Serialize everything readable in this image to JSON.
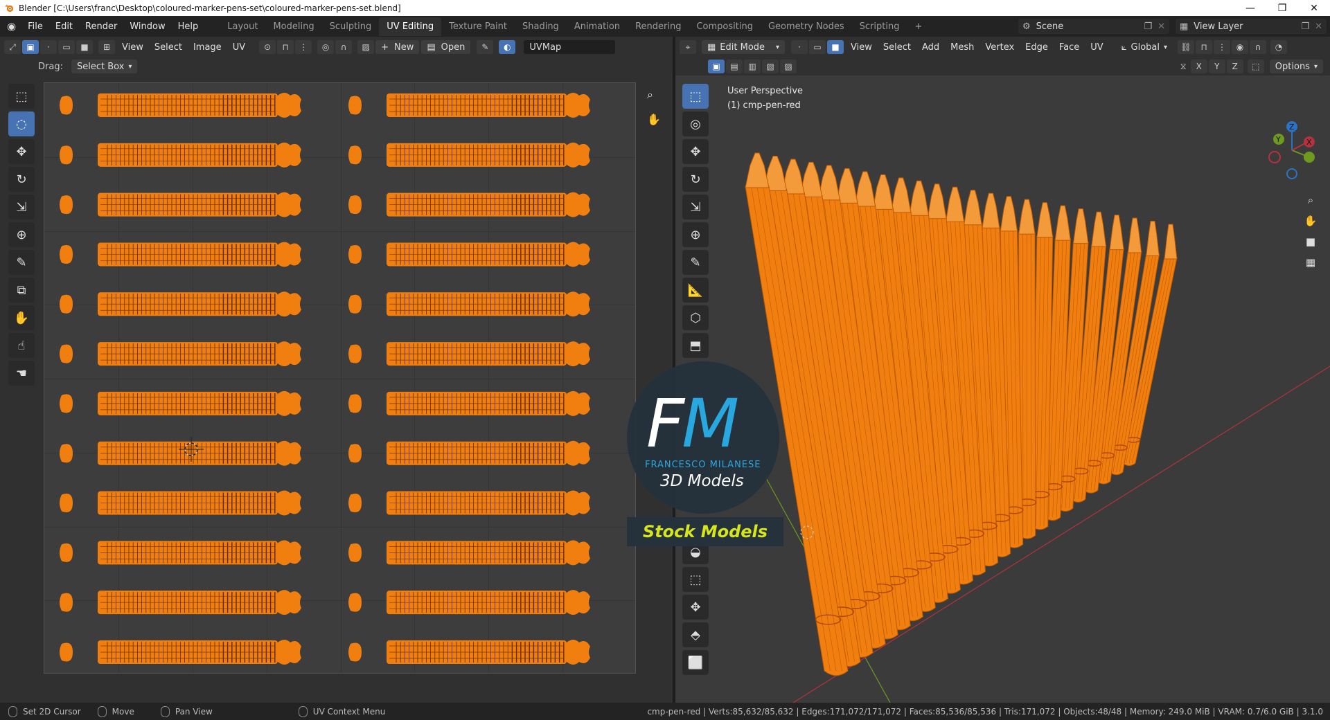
{
  "window": {
    "title": "Blender [C:\\Users\\franc\\Desktop\\coloured-marker-pens-set\\coloured-marker-pens-set.blend]",
    "controls": [
      "—",
      "❐",
      "✕"
    ]
  },
  "topbar": {
    "menus": [
      "File",
      "Edit",
      "Render",
      "Window",
      "Help"
    ],
    "workspaces": [
      "Layout",
      "Modeling",
      "Sculpting",
      "UV Editing",
      "Texture Paint",
      "Shading",
      "Animation",
      "Rendering",
      "Compositing",
      "Geometry Nodes",
      "Scripting"
    ],
    "active_workspace": "UV Editing",
    "add_tab": "+",
    "scene": "Scene",
    "view_layer": "View Layer"
  },
  "uv_editor": {
    "menus": [
      "View",
      "Select",
      "Image",
      "UV"
    ],
    "new_label": "New",
    "open_label": "Open",
    "uvmap": "UVMap",
    "drag_label": "Drag:",
    "drag_value": "Select Box",
    "tools": [
      "cursor-select",
      "select-box",
      "move",
      "rotate",
      "scale",
      "transform",
      "annotate",
      "rip",
      "grab",
      "relax",
      "pinch"
    ],
    "island_rows": 12,
    "island_cols": 2
  },
  "viewport": {
    "mode": "Edit Mode",
    "menus": [
      "View",
      "Select",
      "Add",
      "Mesh",
      "Vertex",
      "Edge",
      "Face",
      "UV"
    ],
    "orientation": "Global",
    "options_label": "Options",
    "axes": [
      "X",
      "Y",
      "Z"
    ],
    "perspective": "User Perspective",
    "object_label": "(1) cmp-pen-red",
    "pen_count": 24,
    "colors": {
      "mesh": "#f07f10",
      "wire": "#c05a00",
      "x_axis": "#b2333f",
      "y_axis": "#6d9a1f"
    }
  },
  "watermark": {
    "fm_f": "F",
    "fm_m": "M",
    "name": "FRANCESCO MILANESE",
    "subtitle": "3D Models",
    "banner": "Stock Models"
  },
  "statusbar": {
    "hints": [
      "Set 2D Cursor",
      "Move",
      "Pan View",
      "UV Context Menu"
    ],
    "stats": "cmp-pen-red | Verts:85,632/85,632 | Edges:171,072/171,072 | Faces:85,536/85,536 | Tris:171,072 | Objects:48/48 | Memory: 249.0 MiB | VRAM: 0.7/6.0 GiB | 3.1.0"
  }
}
